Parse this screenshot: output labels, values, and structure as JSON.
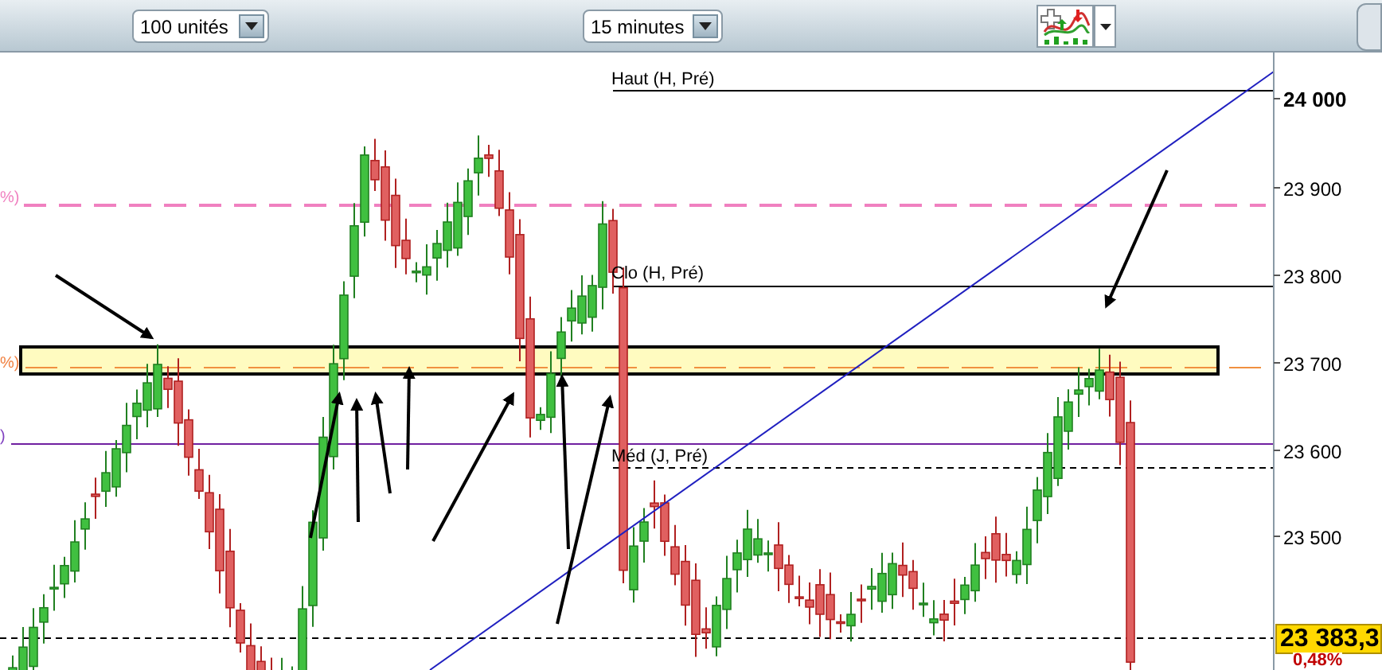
{
  "toolbar": {
    "quantity_select": {
      "value": "100 unités"
    },
    "interval_select": {
      "value": "15 minutes"
    }
  },
  "chart": {
    "level_labels": [
      {
        "label": "Haut (H, Pré)"
      },
      {
        "label": "Clo (H, Pré)"
      },
      {
        "label": "Méd (J, Pré)"
      }
    ],
    "left_labels": [
      {
        "label": "%)",
        "color": "#f080c0"
      },
      {
        "label": "%)",
        "color": "#f08040"
      },
      {
        "label": ")",
        "color": "#8040c0"
      }
    ],
    "y_axis_labels": [
      "24 000",
      "23 900",
      "23 800",
      "23 700",
      "23 600",
      "23 500"
    ],
    "last_price": "23 383,3",
    "change": "0,48%"
  }
}
